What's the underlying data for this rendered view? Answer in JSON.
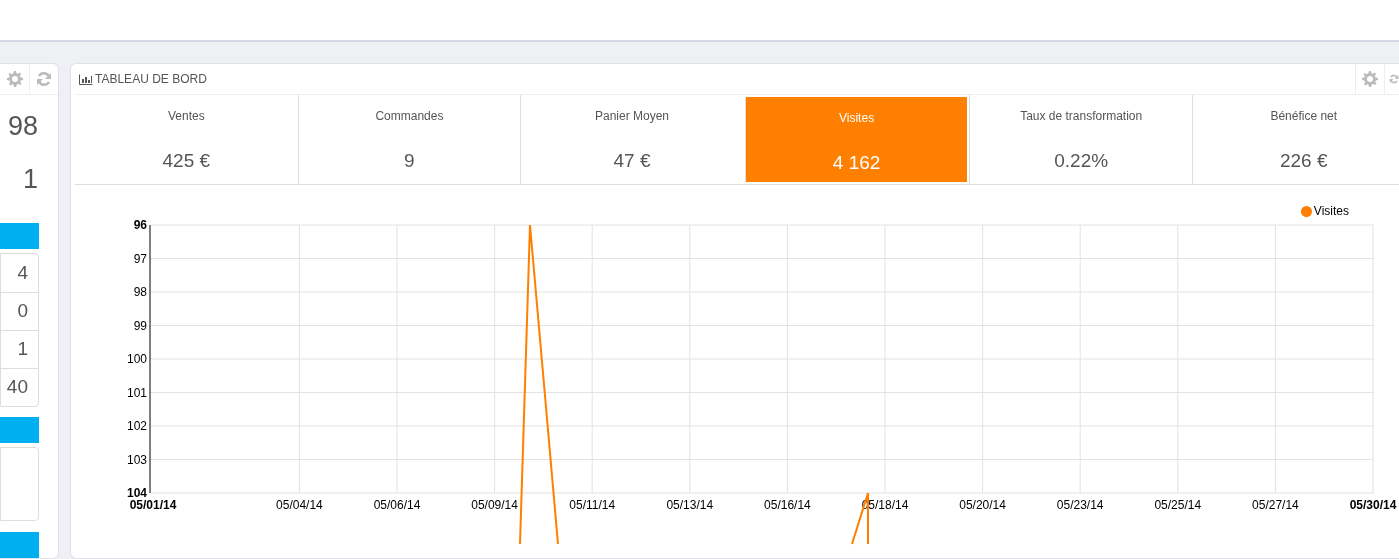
{
  "side_panel": {
    "values": [
      "98",
      "1"
    ],
    "table_rows": [
      "4",
      "0",
      "1",
      "40"
    ]
  },
  "dashboard": {
    "title": "TABLEAU DE BORD",
    "kpis": [
      {
        "label": "Ventes",
        "value": "425 €",
        "selected": false
      },
      {
        "label": "Commandes",
        "value": "9",
        "selected": false
      },
      {
        "label": "Panier Moyen",
        "value": "47 €",
        "selected": false
      },
      {
        "label": "Visites",
        "value": "4 162",
        "selected": true
      },
      {
        "label": "Taux de transformation",
        "value": "0.22%",
        "selected": false
      },
      {
        "label": "Bénéfice net",
        "value": "226 €",
        "selected": false
      }
    ],
    "chart": {
      "legend": {
        "label": "Visites",
        "color": "#ff7f00"
      },
      "x_labels": [
        "05/01/14",
        "05/04/14",
        "05/06/14",
        "05/09/14",
        "05/11/14",
        "05/13/14",
        "05/16/14",
        "05/18/14",
        "05/20/14",
        "05/23/14",
        "05/25/14",
        "05/27/14",
        "05/30/14"
      ],
      "y_labels": [
        "96",
        "97",
        "98",
        "99",
        "100",
        "101",
        "102",
        "103",
        "104"
      ]
    }
  }
}
